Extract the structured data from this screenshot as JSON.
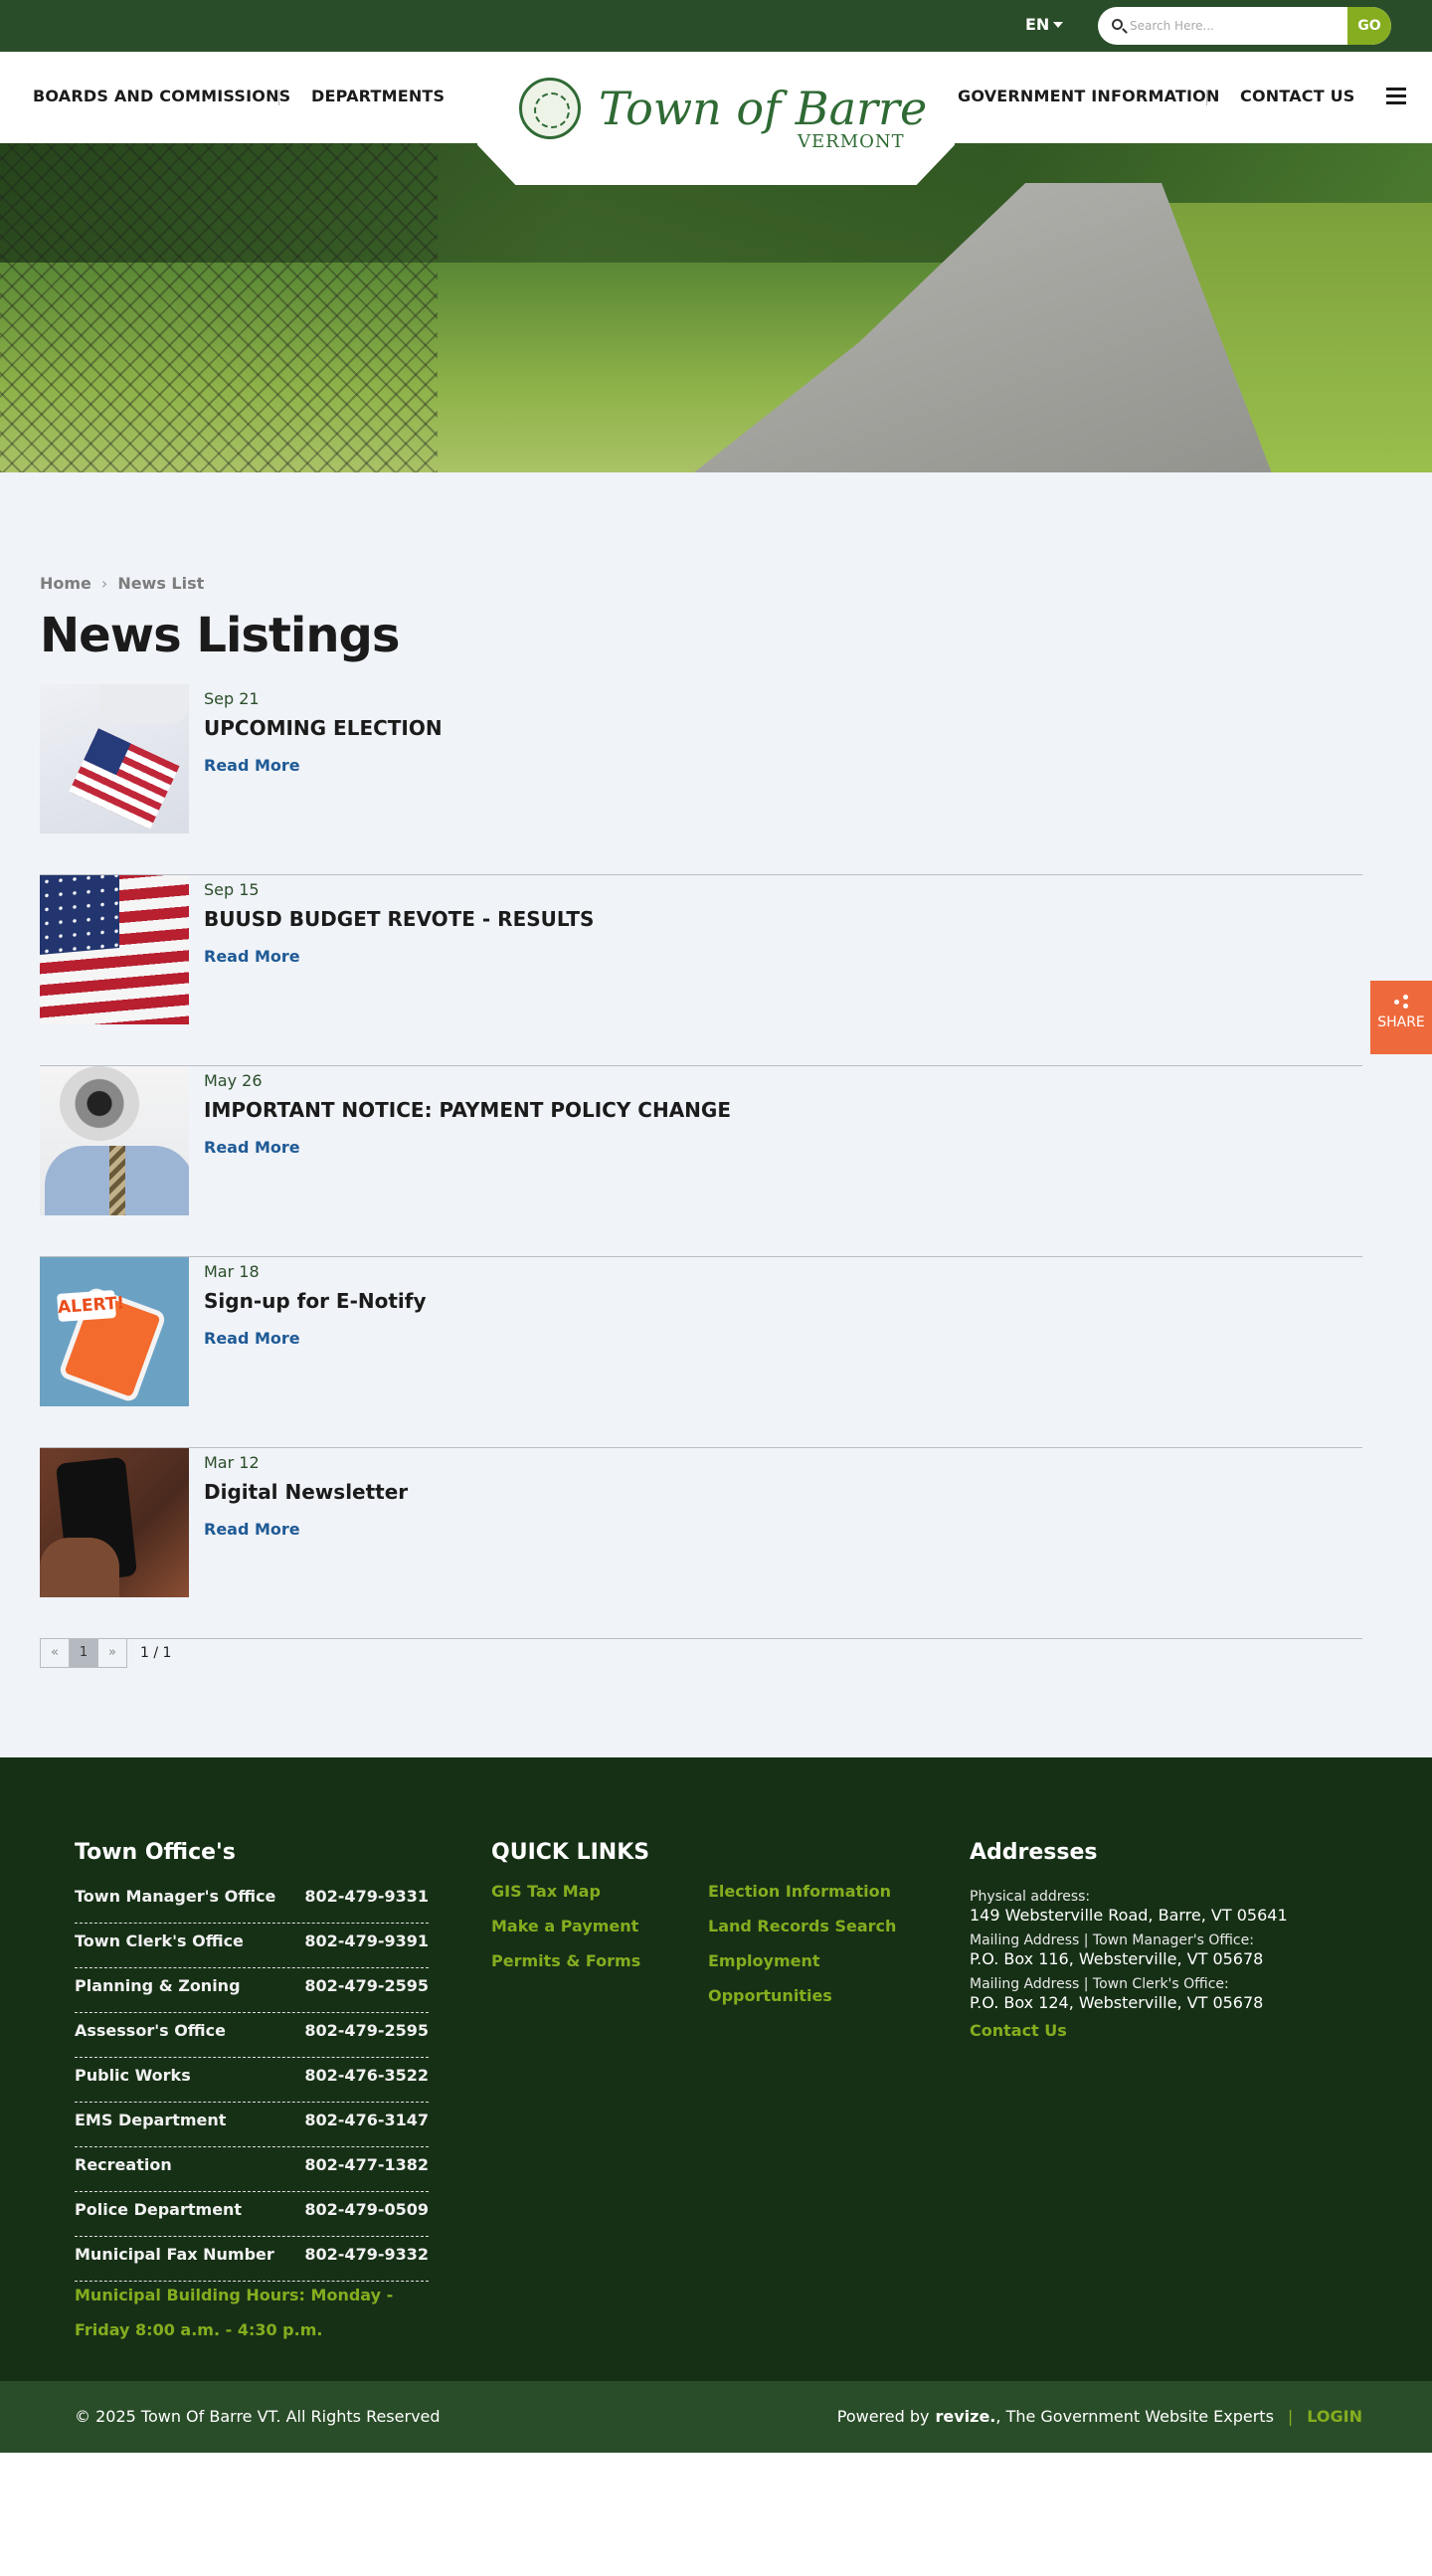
{
  "topbar": {
    "language": "EN",
    "search_placeholder": "Search Here...",
    "search_button": "GO"
  },
  "nav": {
    "left": [
      "BOARDS AND COMMISSIONS",
      "DEPARTMENTS"
    ],
    "right": [
      "GOVERNMENT INFORMATION",
      "CONTACT US"
    ]
  },
  "logo": {
    "name": "Town of Barre",
    "sub": "VERMONT"
  },
  "breadcrumb": {
    "home": "Home",
    "separator": "›",
    "current": "News List"
  },
  "page_title": "News Listings",
  "news": [
    {
      "date": "Sep 21",
      "title": "UPCOMING ELECTION",
      "link": "Read More"
    },
    {
      "date": "Sep 15",
      "title": "BUUSD BUDGET REVOTE - RESULTS",
      "link": "Read More"
    },
    {
      "date": "May 26",
      "title": "IMPORTANT NOTICE: PAYMENT POLICY CHANGE",
      "link": "Read More"
    },
    {
      "date": "Mar 18",
      "title": "Sign-up for E-Notify",
      "link": "Read More",
      "thumb_text": "ALERT!"
    },
    {
      "date": "Mar 12",
      "title": "Digital Newsletter",
      "link": "Read More"
    }
  ],
  "pagination": {
    "prev": "«",
    "page": "1",
    "next": "»",
    "info": "1 / 1"
  },
  "share": {
    "label": "SHARE"
  },
  "footer": {
    "offices_heading": "Town Office's",
    "offices": [
      {
        "name": "Town Manager's Office",
        "phone": "802-479-9331"
      },
      {
        "name": "Town Clerk's Office",
        "phone": "802-479-9391"
      },
      {
        "name": "Planning & Zoning",
        "phone": "802-479-2595"
      },
      {
        "name": "Assessor's Office",
        "phone": "802-479-2595"
      },
      {
        "name": "Public Works",
        "phone": "802-476-3522"
      },
      {
        "name": "EMS Department",
        "phone": "802-476-3147"
      },
      {
        "name": "Recreation",
        "phone": "802-477-1382"
      },
      {
        "name": "Police Department",
        "phone": "802-479-0509"
      },
      {
        "name": "Municipal Fax Number",
        "phone": "802-479-9332"
      }
    ],
    "hours": "Municipal Building Hours:  Monday - Friday 8:00 a.m. - 4:30 p.m.",
    "quick_links_heading": "QUICK LINKS",
    "quick_links_col1": [
      "GIS Tax Map",
      "Make a Payment",
      "Permits & Forms"
    ],
    "quick_links_col2": [
      "Election Information",
      "Land Records Search",
      "Employment",
      "Opportunities"
    ],
    "addresses_heading": "Addresses",
    "addresses": [
      {
        "label": "Physical address:",
        "value": "149 Websterville Road, Barre, VT 05641"
      },
      {
        "label": "Mailing Address | Town Manager's Office:",
        "value": "P.O. Box 116, Websterville, VT 05678"
      },
      {
        "label": "Mailing Address | Town Clerk's Office:",
        "value": "P.O. Box 124, Websterville, VT 05678"
      }
    ],
    "contact_link": "Contact Us"
  },
  "bottom": {
    "copyright": "© 2025 Town Of Barre VT. All Rights Reserved",
    "powered_prefix": "Powered by",
    "powered_brand": "revize.",
    "powered_suffix": ", The Government Website Experts",
    "divider": "|",
    "login": "LOGIN"
  },
  "colors": {
    "topbar": "#2a4d29",
    "footer": "#163016",
    "accent_green": "#85ad1f",
    "link_blue": "#1f5a96",
    "share_orange": "#ee6a3c",
    "content_bg": "#f0f3f8"
  }
}
